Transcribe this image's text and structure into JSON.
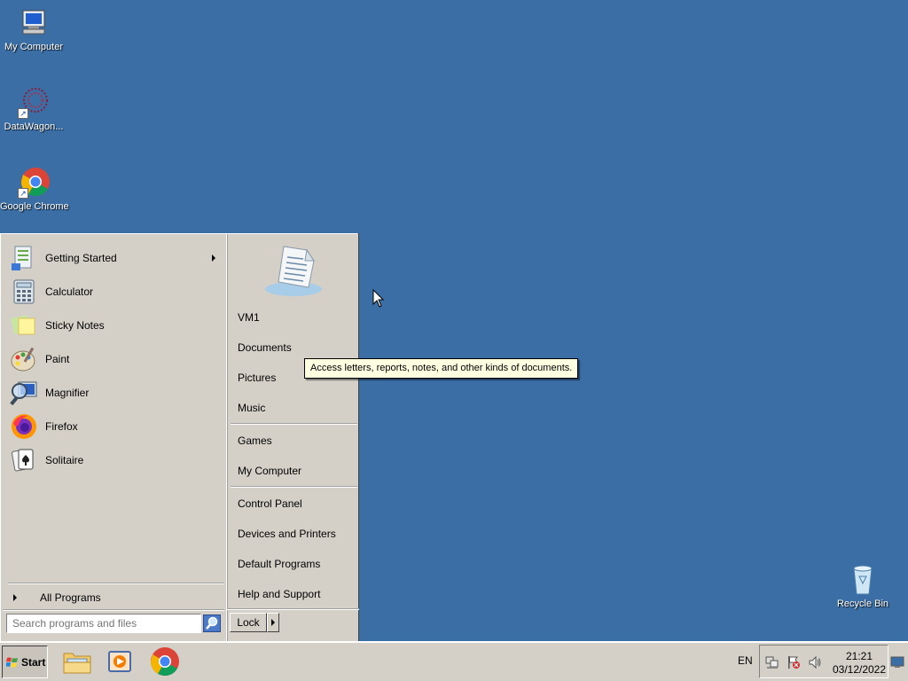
{
  "desktop": {
    "icons": [
      {
        "label": "My Computer",
        "icon": "computer-icon"
      },
      {
        "label": "DataWagon...",
        "icon": "datawagon-icon"
      },
      {
        "label": "Google Chrome",
        "icon": "chrome-icon"
      },
      {
        "label": "Recycle Bin",
        "icon": "recycle-bin-icon"
      }
    ],
    "background_color": "#3a6ea5"
  },
  "start_menu": {
    "programs": [
      {
        "label": "Getting Started",
        "icon": "getting-started-icon",
        "has_submenu": true
      },
      {
        "label": "Calculator",
        "icon": "calculator-icon"
      },
      {
        "label": "Sticky Notes",
        "icon": "sticky-notes-icon"
      },
      {
        "label": "Paint",
        "icon": "paint-icon"
      },
      {
        "label": "Magnifier",
        "icon": "magnifier-icon"
      },
      {
        "label": "Firefox",
        "icon": "firefox-icon"
      },
      {
        "label": "Solitaire",
        "icon": "solitaire-icon"
      }
    ],
    "all_programs_label": "All Programs",
    "search_placeholder": "Search programs and files",
    "right_items": {
      "user": "VM1",
      "documents": "Documents",
      "pictures": "Pictures",
      "music": "Music",
      "games": "Games",
      "my_computer": "My Computer",
      "control_panel": "Control Panel",
      "devices_printers": "Devices and Printers",
      "default_programs": "Default Programs",
      "help_support": "Help and Support"
    },
    "lock_label": "Lock"
  },
  "tooltip": {
    "text": "Access letters, reports, notes, and other kinds of documents."
  },
  "taskbar": {
    "start_label": "Start",
    "pinned": [
      "file-explorer-icon",
      "media-player-icon",
      "chrome-icon"
    ],
    "language": "EN",
    "time": "21:21",
    "date": "03/12/2022"
  }
}
